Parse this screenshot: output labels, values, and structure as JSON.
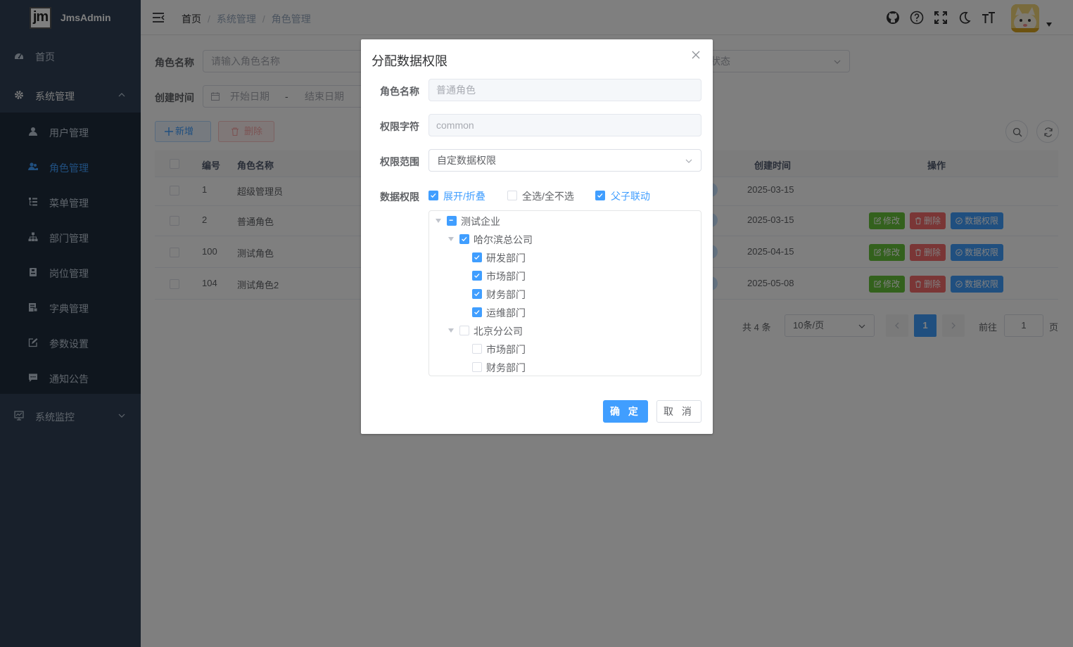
{
  "app": {
    "title": "JmsAdmin",
    "logo_text": "jm"
  },
  "sidebar": {
    "items": [
      {
        "label": "首页"
      },
      {
        "label": "系统管理"
      },
      {
        "label": "系统监控"
      }
    ],
    "sub_items": [
      {
        "label": "用户管理"
      },
      {
        "label": "角色管理"
      },
      {
        "label": "菜单管理"
      },
      {
        "label": "部门管理"
      },
      {
        "label": "岗位管理"
      },
      {
        "label": "字典管理"
      },
      {
        "label": "参数设置"
      },
      {
        "label": "通知公告"
      }
    ]
  },
  "header": {
    "breadcrumb": [
      "首页",
      "系统管理",
      "角色管理"
    ],
    "separator": "/"
  },
  "search": {
    "role_name_label": "角色名称",
    "role_name_placeholder": "请输入角色名称",
    "status_placeholder": "状态",
    "created_label": "创建时间",
    "start_placeholder": "开始日期",
    "range_sep": "-",
    "end_placeholder": "结束日期"
  },
  "toolbar": {
    "add_label": "新增",
    "delete_label": "删除"
  },
  "table": {
    "headers": {
      "id": "编号",
      "name": "角色名称",
      "created": "创建时间",
      "actions": "操作"
    },
    "rows": [
      {
        "id": "1",
        "name": "超级管理员",
        "created": "2025-03-15"
      },
      {
        "id": "2",
        "name": "普通角色",
        "created": "2025-03-15"
      },
      {
        "id": "100",
        "name": "测试角色",
        "created": "2025-04-15"
      },
      {
        "id": "104",
        "name": "测试角色2",
        "created": "2025-05-08"
      }
    ],
    "action_labels": {
      "edit": "修改",
      "delete": "删除",
      "perm": "数据权限"
    }
  },
  "pagination": {
    "total": "共 4 条",
    "page_size": "10条/页",
    "current": "1",
    "goto_label": "前往",
    "goto_value": "1",
    "page_suffix": "页"
  },
  "dialog": {
    "title": "分配数据权限",
    "role_name_label": "角色名称",
    "role_name_value": "普通角色",
    "role_key_label": "权限字符",
    "role_key_value": "common",
    "scope_label": "权限范围",
    "scope_value": "自定数据权限",
    "data_perm_label": "数据权限",
    "options": {
      "expand": {
        "label": "展开/折叠",
        "checked": true
      },
      "select_all": {
        "label": "全选/全不选",
        "checked": false
      },
      "linkage": {
        "label": "父子联动",
        "checked": true
      }
    },
    "tree": [
      {
        "label": "测试企业",
        "level": 0,
        "state": "indeterminate",
        "expanded": true
      },
      {
        "label": "哈尔滨总公司",
        "level": 1,
        "state": "checked",
        "expanded": true
      },
      {
        "label": "研发部门",
        "level": 2,
        "state": "checked"
      },
      {
        "label": "市场部门",
        "level": 2,
        "state": "checked"
      },
      {
        "label": "财务部门",
        "level": 2,
        "state": "checked"
      },
      {
        "label": "运维部门",
        "level": 2,
        "state": "checked"
      },
      {
        "label": "北京分公司",
        "level": 1,
        "state": "unchecked",
        "expanded": true
      },
      {
        "label": "市场部门",
        "level": 2,
        "state": "unchecked"
      },
      {
        "label": "财务部门",
        "level": 2,
        "state": "unchecked"
      }
    ],
    "ok_label": "确 定",
    "cancel_label": "取 消"
  },
  "colors": {
    "primary": "#409eff",
    "sidebar_bg": "#304156",
    "submenu_bg": "#1f2d3d",
    "success": "#67c23a",
    "danger": "#f56c6c"
  }
}
